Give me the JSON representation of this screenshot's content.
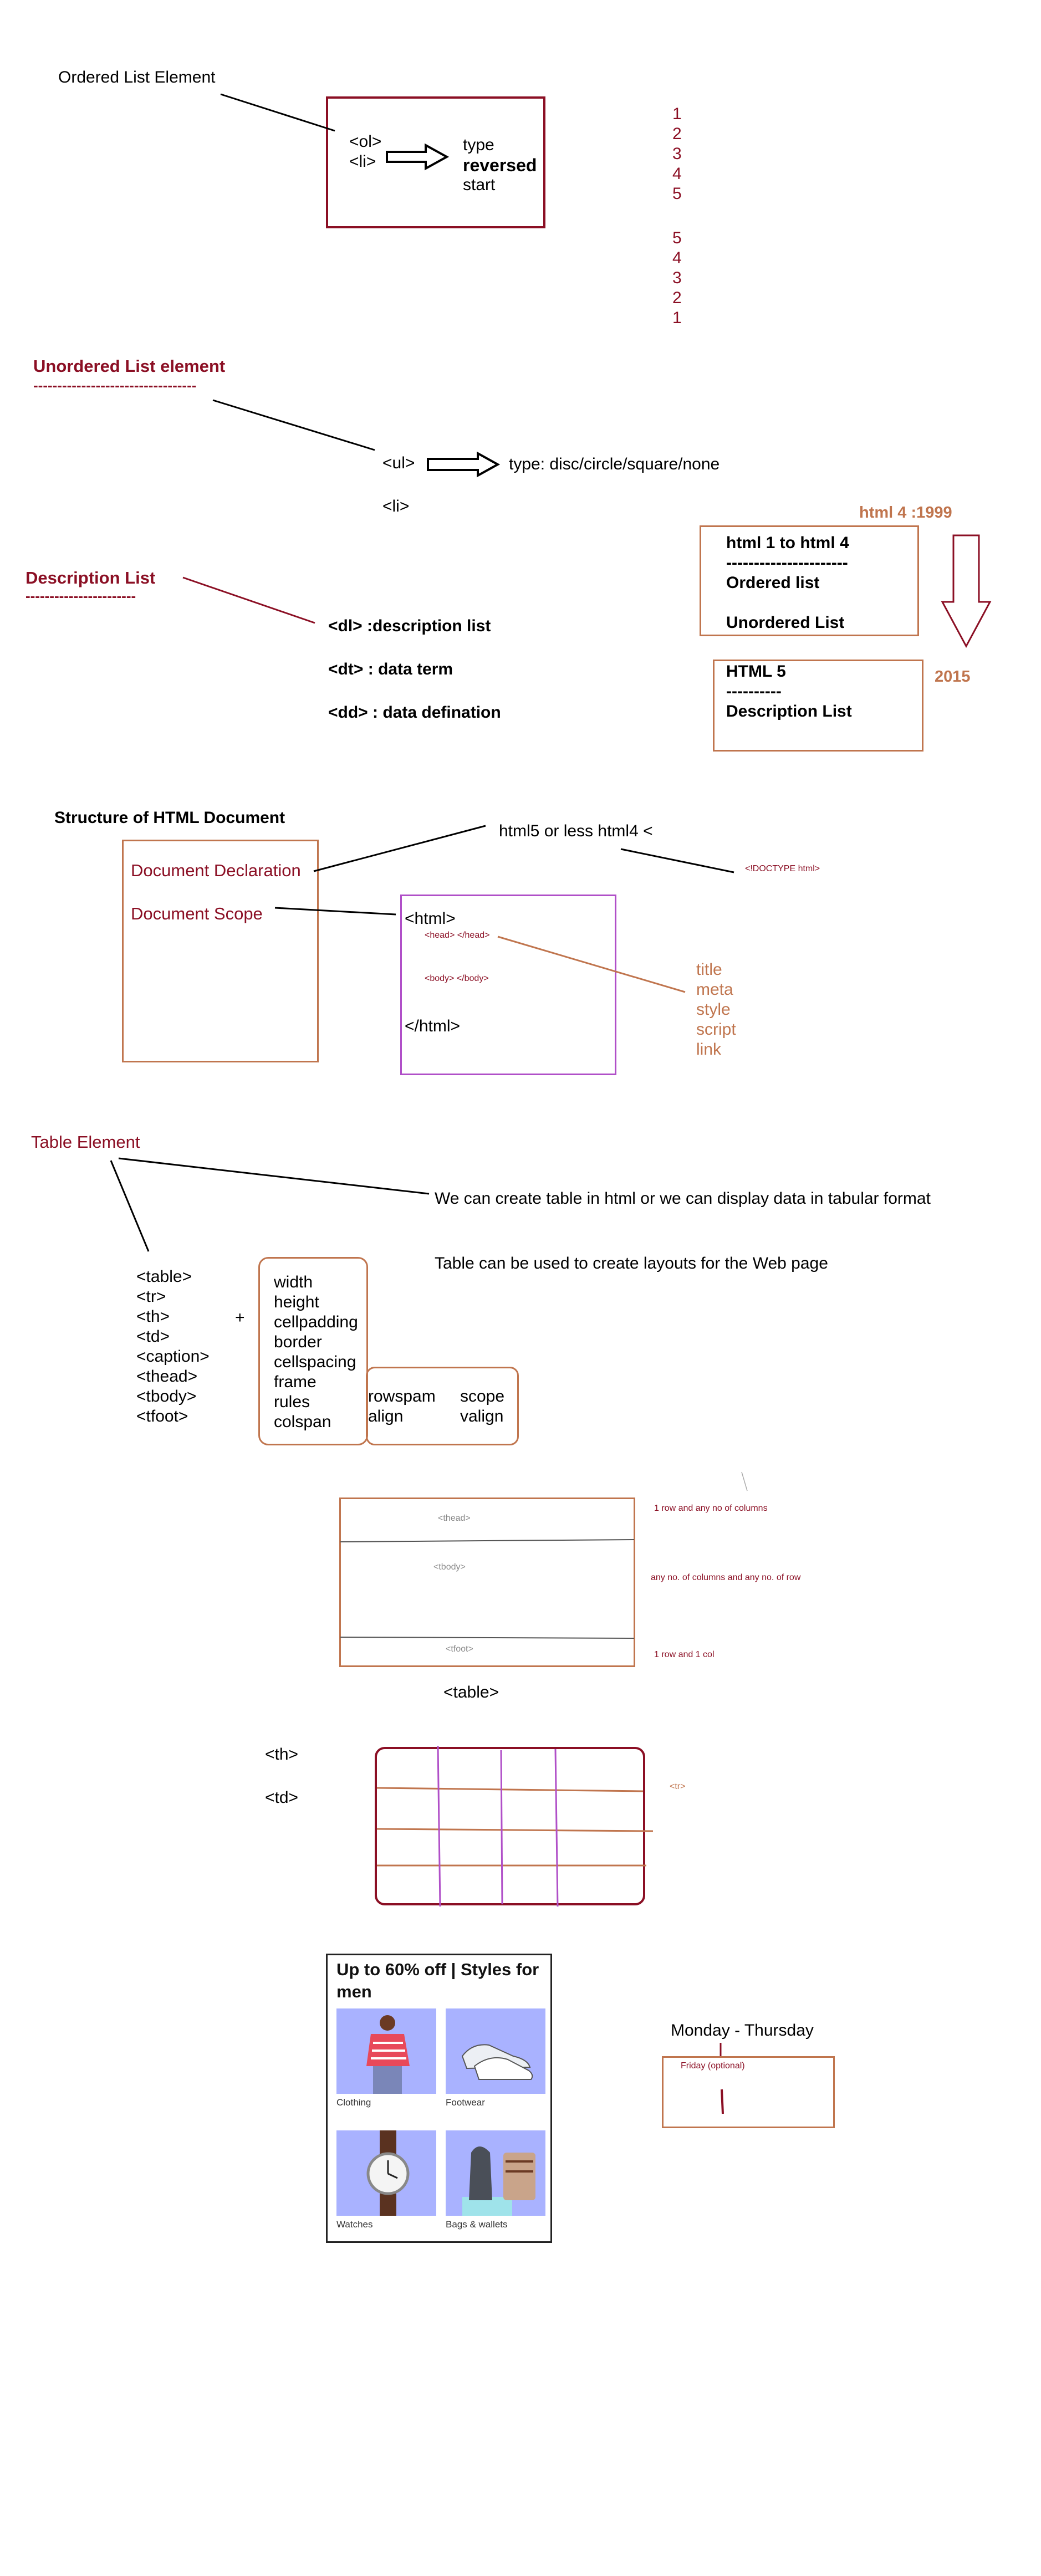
{
  "ordered": {
    "title": "Ordered List Element",
    "tags": [
      "<ol>",
      "<li>"
    ],
    "attrs": [
      "type",
      "reversed",
      "start"
    ],
    "asc": [
      "1",
      "2",
      "3",
      "4",
      "5"
    ],
    "desc": [
      "5",
      "4",
      "3",
      "2",
      "1"
    ]
  },
  "unordered": {
    "title": "Unordered List element",
    "underline": "----------------------------------",
    "ul": "<ul>",
    "li": "<li>",
    "type": "type: disc/circle/square/none"
  },
  "description": {
    "title": "Description List",
    "underline": "-----------------------",
    "items": [
      "<dl> :description list",
      "<dt> : data term",
      "<dd> : data defination"
    ]
  },
  "history": {
    "html4_label": "html 4 :1999",
    "box1": [
      "html 1 to html 4",
      "----------------------",
      "Ordered list",
      "",
      "Unordered List"
    ],
    "year": "2015",
    "box2": [
      "HTML 5",
      "----------",
      "Description List"
    ]
  },
  "structure": {
    "title": "Structure of HTML Document",
    "declaration": "Document Declaration",
    "scope": "Document Scope",
    "versions": "html5 or less html4 <",
    "doctype": "<!DOCTYPE html>",
    "html_open": "<html>",
    "head": "<head>  </head>",
    "body": "<body> </body>",
    "html_close": "</html>",
    "head_items": [
      "title",
      "meta",
      "style",
      "script",
      "link"
    ]
  },
  "table": {
    "title": "Table Element",
    "desc1": "We can create table in html or we can display data in tabular format",
    "desc2": "Table can be used to create layouts for the Web page",
    "tags": [
      "<table>",
      "<tr>",
      "<th>",
      "<td>",
      "<caption>",
      "<thead>",
      "<tbody>",
      "<tfoot>"
    ],
    "plus": "+",
    "attrs": [
      "width",
      "height",
      "cellpadding",
      "border",
      "cellspacing",
      "frame",
      "rules",
      "colspan"
    ],
    "attrs2": [
      "rowspam",
      "align"
    ],
    "attrs3": [
      "scope",
      "valign"
    ],
    "thead": "<thead>",
    "tbody": "<tbody>",
    "tfoot": "<tfoot>",
    "table_label": "<table>",
    "thead_note": "1 row and any no of columns",
    "tbody_note": "any no. of columns and any no. of row",
    "tfoot_note": "1 row and 1 col",
    "th": "<th>",
    "td": "<td>",
    "tr": "<tr>"
  },
  "card": {
    "title": "Up to 60% off | Styles for men",
    "tiles": [
      {
        "label": "Clothing",
        "icon": "shirt-icon"
      },
      {
        "label": "Footwear",
        "icon": "shoe-icon"
      },
      {
        "label": "Watches",
        "icon": "watch-icon"
      },
      {
        "label": "Bags & wallets",
        "icon": "bag-icon"
      }
    ]
  },
  "schedule": {
    "days": "Monday - Thursday",
    "friday": "Friday (optional)"
  },
  "colors": {
    "dark_red": "#8b0f24",
    "orange": "#c0754e",
    "purple": "#b04fc8",
    "tile_blue": "#a9b2ff"
  }
}
